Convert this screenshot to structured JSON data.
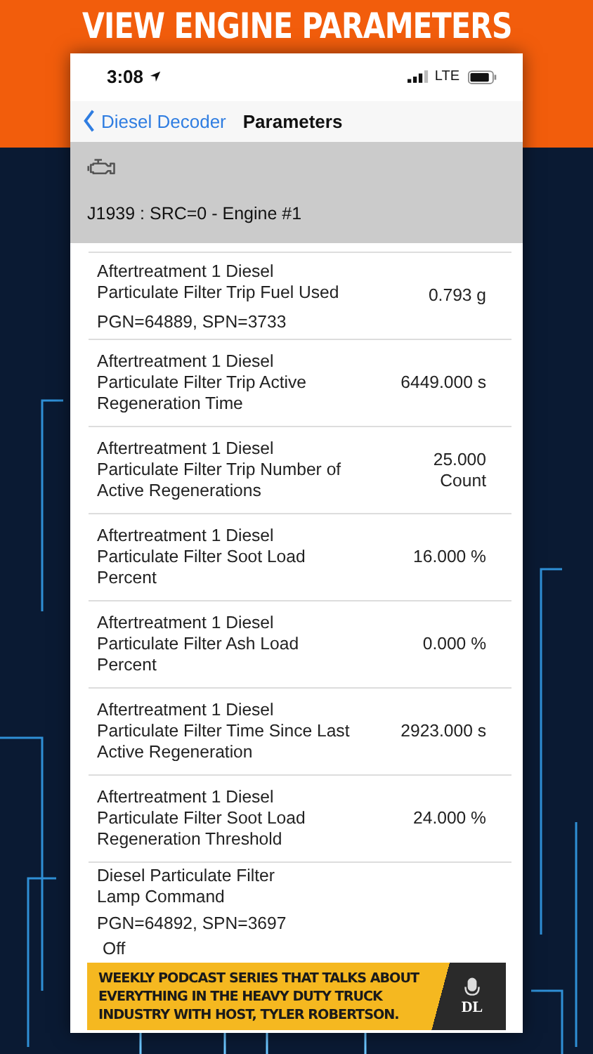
{
  "headline": "VIEW ENGINE PARAMETERS",
  "status_bar": {
    "time": "3:08",
    "network": "LTE"
  },
  "nav": {
    "back": "Diesel Decoder",
    "title": "Parameters"
  },
  "section": {
    "title": "J1939 : SRC=0 - Engine #1"
  },
  "rows": [
    {
      "kind": "inline",
      "name": "Aftertreatment 1 Diesel Particulate Filter Trip Fuel Used",
      "value": "0.793 g",
      "pgn": "PGN=64889, SPN=3733"
    },
    {
      "kind": "inline",
      "name": "Aftertreatment 1 Diesel Particulate Filter Trip Active Regeneration Time",
      "value": "6449.000 s"
    },
    {
      "kind": "inline",
      "name": "Aftertreatment 1 Diesel Particulate Filter Trip Number of Active Regenerations",
      "value": "25.000 Count"
    },
    {
      "kind": "inline",
      "name": "Aftertreatment 1 Diesel Particulate Filter Soot Load Percent",
      "value": "16.000 %"
    },
    {
      "kind": "inline",
      "name": "Aftertreatment 1 Diesel Particulate Filter Ash Load Percent",
      "value": "0.000 %"
    },
    {
      "kind": "inline",
      "name": "Aftertreatment 1 Diesel Particulate Filter Time Since Last Active Regeneration",
      "value": "2923.000 s"
    },
    {
      "kind": "inline",
      "name": "Aftertreatment 1 Diesel Particulate Filter Soot Load Regeneration Threshold",
      "value": "24.000 %"
    },
    {
      "kind": "below",
      "name": "Diesel Particulate Filter Lamp Command",
      "value": "Off",
      "pgn": "PGN=64892, SPN=3697"
    }
  ],
  "banner": {
    "text": "WEEKLY PODCAST SERIES THAT TALKS ABOUT EVERYTHING IN THE HEAVY DUTY TRUCK INDUSTRY WITH HOST, TYLER ROBERTSON.",
    "logo": "DL"
  }
}
